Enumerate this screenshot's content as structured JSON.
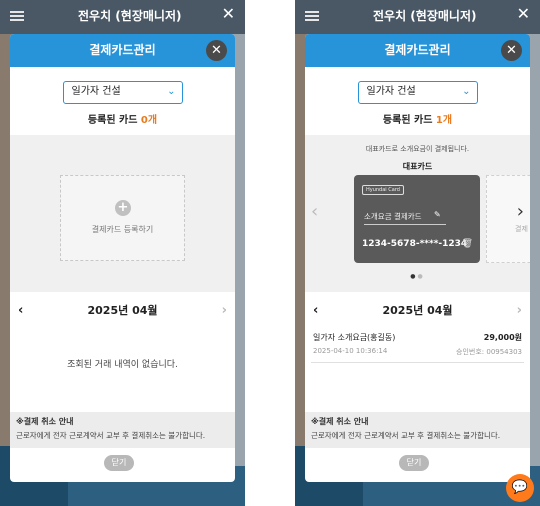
{
  "background": {
    "title": "전우치 (현장매니저)"
  },
  "left": {
    "modal_title": "결제카드관리",
    "company_select": "일가자 건설",
    "count_prefix": "등록된 카드 ",
    "count_value": "0개",
    "add_card_label": "결제카드 등록하기",
    "month": "2025년 04월",
    "empty_message": "조회된 거래 내역이 없습니다.",
    "notice_title": "※결제 취소 안내",
    "notice_text": "근로자에게 전자 근로계약서 교부 후 결제취소는 불가합니다.",
    "close_label": "닫기"
  },
  "right": {
    "modal_title": "결제카드관리",
    "company_select": "일가자 건설",
    "count_prefix": "등록된 카드 ",
    "count_value": "1개",
    "rep_note": "대표카드로 소개요금이 결제됩니다.",
    "rep_title": "대표카드",
    "card_brand": "Hyundai Card",
    "card_name": "소개요금 결제카드",
    "card_number": "1234-5678-****-1234",
    "ghost_label": "결제",
    "month": "2025년 04월",
    "transaction": {
      "name": "일가자 소개요금(홍길동)",
      "amount": "29,000원",
      "datetime": "2025-04-10 10:36:14",
      "approval": "승인번호: 00954303"
    },
    "notice_title": "※결제 취소 안내",
    "notice_text": "근로자에게 전자 근로계약서 교부 후 결제취소는 불가합니다.",
    "close_label": "닫기"
  }
}
